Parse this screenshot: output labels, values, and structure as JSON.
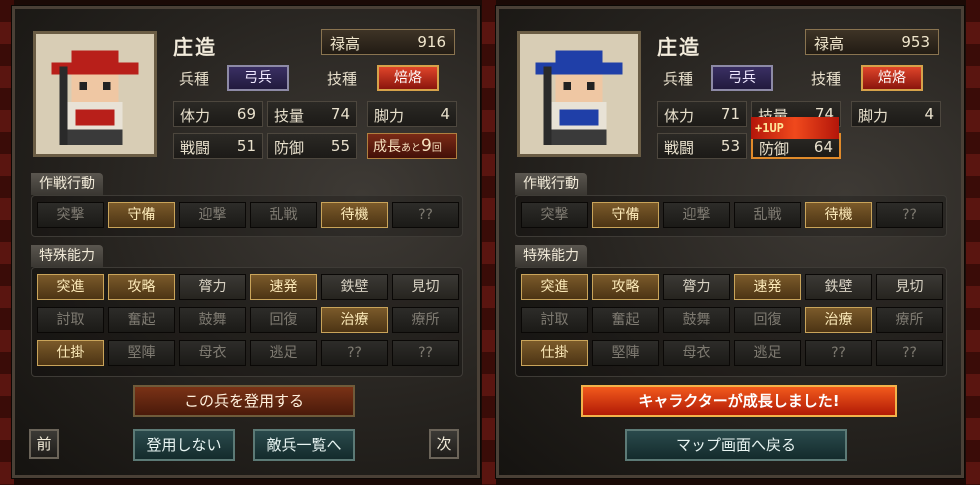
{
  "left": {
    "name": "庄造",
    "salary_label": "禄高",
    "salary_value": "916",
    "troop_label": "兵種",
    "troop_value": "弓兵",
    "skill_label": "技種",
    "skill_value": "焙烙",
    "stats": [
      {
        "label": "体力",
        "value": "69"
      },
      {
        "label": "技量",
        "value": "74"
      },
      {
        "label": "脚力",
        "value": "4"
      },
      {
        "label": "戦闘",
        "value": "51"
      },
      {
        "label": "防御",
        "value": "55"
      }
    ],
    "growth": {
      "prefix": "成長",
      "small": "あと",
      "value": "9",
      "suffix": "回"
    },
    "tactics_title": "作戦行動",
    "tactics": [
      "突撃",
      "守備",
      "迎撃",
      "乱戦",
      "待機",
      "??"
    ],
    "tactics_on": [
      false,
      true,
      false,
      false,
      true,
      false
    ],
    "abilities_title": "特殊能力",
    "abilities": [
      "突進",
      "攻略",
      "膂力",
      "速発",
      "鉄壁",
      "見切",
      "討取",
      "奮起",
      "鼓舞",
      "回復",
      "治療",
      "療所",
      "仕掛",
      "堅陣",
      "母衣",
      "逃足",
      "??",
      "??"
    ],
    "abilities_state": [
      "on",
      "on",
      "mid",
      "on",
      "mid",
      "mid",
      "off",
      "off",
      "off",
      "off",
      "on",
      "off",
      "on",
      "off",
      "off",
      "off",
      "off",
      "off"
    ],
    "recruit_button": "この兵を登用する",
    "decline_button": "登用しない",
    "enemy_list_button": "敵兵一覧へ",
    "prev_button": "前",
    "next_button": "次"
  },
  "right": {
    "name": "庄造",
    "salary_label": "禄高",
    "salary_value": "953",
    "troop_label": "兵種",
    "troop_value": "弓兵",
    "skill_label": "技種",
    "skill_value": "焙烙",
    "stats": [
      {
        "label": "体力",
        "value": "71"
      },
      {
        "label": "技量",
        "value": "74"
      },
      {
        "label": "脚力",
        "value": "4"
      },
      {
        "label": "戦闘",
        "value": "53"
      },
      {
        "label": "防御",
        "value": "64"
      }
    ],
    "level_up_text": "+1UP",
    "tactics_title": "作戦行動",
    "tactics": [
      "突撃",
      "守備",
      "迎撃",
      "乱戦",
      "待機",
      "??"
    ],
    "tactics_on": [
      false,
      true,
      false,
      false,
      true,
      false
    ],
    "abilities_title": "特殊能力",
    "abilities": [
      "突進",
      "攻略",
      "膂力",
      "速発",
      "鉄壁",
      "見切",
      "討取",
      "奮起",
      "鼓舞",
      "回復",
      "治療",
      "療所",
      "仕掛",
      "堅陣",
      "母衣",
      "逃足",
      "??",
      "??"
    ],
    "abilities_state": [
      "on",
      "on",
      "mid",
      "on",
      "mid",
      "mid",
      "off",
      "off",
      "off",
      "off",
      "on",
      "off",
      "on",
      "off",
      "off",
      "off",
      "off",
      "off"
    ],
    "growth_banner": "キャラクターが成長しました!",
    "map_button": "マップ画面へ戻る"
  },
  "colors": {
    "hat_left": "#b81f1a",
    "hat_right": "#1f3fa8",
    "on_button": "#7b5a2a",
    "fire_chip": "#e0452a"
  }
}
